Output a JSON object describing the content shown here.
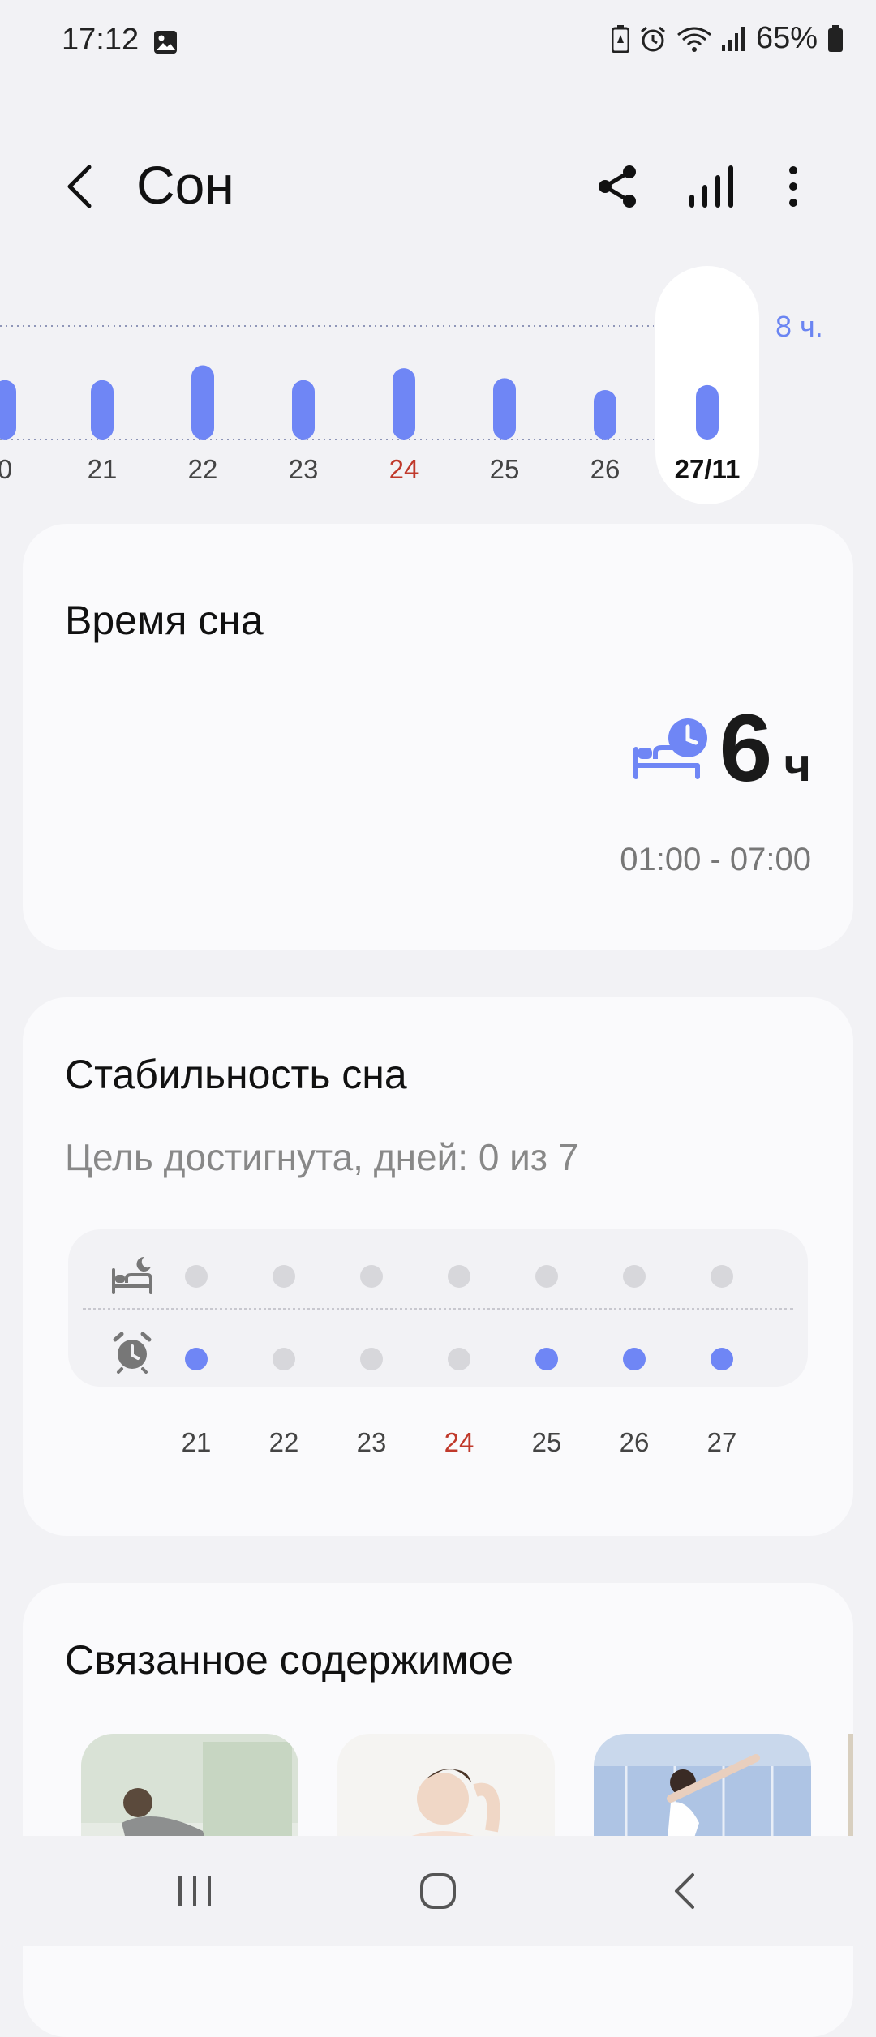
{
  "status": {
    "time": "17:12",
    "battery": "65%"
  },
  "header": {
    "title": "Сон"
  },
  "week_chart": {
    "goal_label": "8 ч.",
    "days": [
      {
        "label": "0",
        "hours": 6.0,
        "color": "normal"
      },
      {
        "label": "21",
        "hours": 6.0,
        "color": "normal"
      },
      {
        "label": "22",
        "hours": 7.5,
        "color": "normal"
      },
      {
        "label": "23",
        "hours": 6.0,
        "color": "normal"
      },
      {
        "label": "24",
        "hours": 7.2,
        "color": "red"
      },
      {
        "label": "25",
        "hours": 6.2,
        "color": "normal"
      },
      {
        "label": "26",
        "hours": 5.0,
        "color": "normal"
      },
      {
        "label": "27/11",
        "hours": 5.5,
        "color": "selected"
      }
    ]
  },
  "sleep_time": {
    "title": "Время сна",
    "value": "6",
    "unit": "ч",
    "range": "01:00 - 07:00"
  },
  "stability": {
    "title": "Стабильность сна",
    "goal_text": "Цель достигнута, дней: 0 из 7",
    "days": [
      {
        "label": "21",
        "bed": false,
        "wake": true,
        "color": "normal"
      },
      {
        "label": "22",
        "bed": false,
        "wake": false,
        "color": "normal"
      },
      {
        "label": "23",
        "bed": false,
        "wake": false,
        "color": "normal"
      },
      {
        "label": "24",
        "bed": false,
        "wake": false,
        "color": "red"
      },
      {
        "label": "25",
        "bed": false,
        "wake": true,
        "color": "normal"
      },
      {
        "label": "26",
        "bed": false,
        "wake": true,
        "color": "normal"
      },
      {
        "label": "27",
        "bed": false,
        "wake": true,
        "color": "normal"
      }
    ]
  },
  "related": {
    "title": "Связанное содержимое"
  },
  "colors": {
    "accent": "#6f86f5",
    "weekend": "#c0392b",
    "inactive": "#d7d7db"
  }
}
